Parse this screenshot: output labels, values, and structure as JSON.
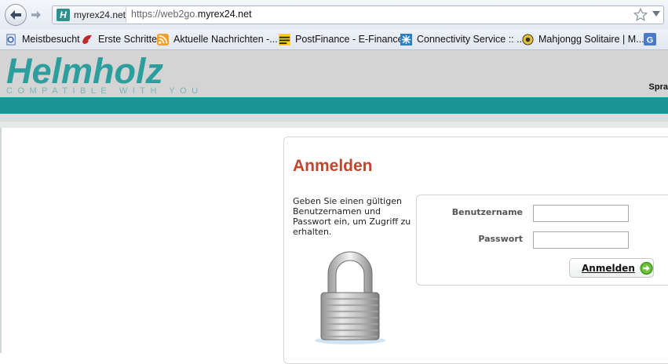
{
  "browser": {
    "identity_label": "myrex24.net",
    "identity_icon_letter": "H",
    "url_prefix": "https://web2go.",
    "url_domain": "myrex24.net",
    "bookmarks": [
      {
        "label": "Meistbesucht",
        "icon": "most-visited-icon"
      },
      {
        "label": "Erste Schritte",
        "icon": "firefox-start-icon"
      },
      {
        "label": "Aktuelle Nachrichten -...",
        "icon": "rss-feed-icon"
      },
      {
        "label": "PostFinance - E-Finance",
        "icon": "postfinance-icon"
      },
      {
        "label": "Connectivity Service :: ...",
        "icon": "snowflake-icon"
      },
      {
        "label": "Mahjongg Solitaire | M...",
        "icon": "mahjongg-icon"
      },
      {
        "label": "G",
        "icon": "google-icon"
      }
    ]
  },
  "header": {
    "logo": "Helmholz",
    "tagline": "COMPATIBLE WITH YOU",
    "lang_label": "Spra"
  },
  "login": {
    "title": "Anmelden",
    "intro": "Geben Sie einen gültigen Benutzernamen und Passwort ein, um Zugriff zu erhalten.",
    "username_label": "Benutzername",
    "password_label": "Passwort",
    "username_value": "",
    "password_value": "",
    "submit_label": "Anmelden"
  },
  "colors": {
    "brand_teal": "#1a9494",
    "logo_teal": "#2d9e9e",
    "title_red": "#c0462e"
  }
}
